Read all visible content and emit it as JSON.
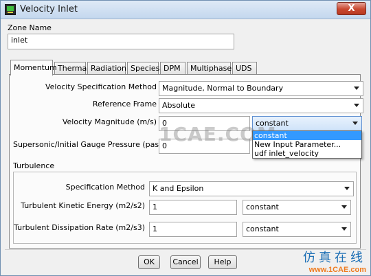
{
  "window": {
    "title": "Velocity Inlet",
    "close_label": "X"
  },
  "zone": {
    "label": "Zone Name",
    "value": "inlet"
  },
  "tabs": [
    {
      "label": "Momentum"
    },
    {
      "label": "Thermal"
    },
    {
      "label": "Radiation"
    },
    {
      "label": "Species"
    },
    {
      "label": "DPM"
    },
    {
      "label": "Multiphase"
    },
    {
      "label": "UDS"
    }
  ],
  "momentum": {
    "velocity_spec_label": "Velocity Specification Method",
    "velocity_spec_value": "Magnitude, Normal to Boundary",
    "ref_frame_label": "Reference Frame",
    "ref_frame_value": "Absolute",
    "vel_mag_label": "Velocity Magnitude (m/s)",
    "vel_mag_value": "0",
    "vel_mag_method": "constant",
    "vel_mag_options": [
      "constant",
      "New Input Parameter...",
      "udf inlet_velocity"
    ],
    "pressure_label": "Supersonic/Initial Gauge Pressure (pascal)",
    "pressure_value": "0"
  },
  "turbulence": {
    "title": "Turbulence",
    "spec_label": "Specification Method",
    "spec_value": "K and Epsilon",
    "tke_label": "Turbulent Kinetic Energy (m2/s2)",
    "tke_value": "1",
    "tke_method": "constant",
    "tdr_label": "Turbulent Dissipation Rate (m2/s3)",
    "tdr_value": "1",
    "tdr_method": "constant"
  },
  "buttons": {
    "ok": "OK",
    "cancel": "Cancel",
    "help": "Help"
  },
  "watermark": {
    "text": "1CAE.COM",
    "brand_cn": "仿真在线",
    "brand_url": "www.1CAE.com"
  }
}
